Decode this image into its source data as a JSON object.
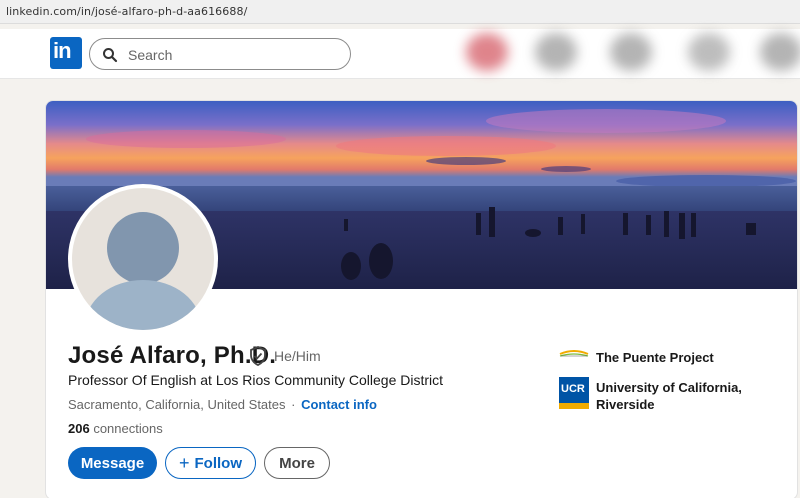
{
  "browser": {
    "url": "linkedin.com/in/josé-alfaro-ph-d-aa616688/"
  },
  "nav": {
    "logo_text": "in",
    "search_placeholder": "Search",
    "search_icon": "search-icon"
  },
  "profile": {
    "name": "José Alfaro, Ph.D.",
    "verified_icon": "verified-shield-icon",
    "pronouns": "He/Him",
    "headline": "Professor Of English at Los Rios Community College District",
    "location": "Sacramento, California, United States",
    "separator": "·",
    "contact_info_label": "Contact info",
    "connections_count": "206",
    "connections_label": "connections"
  },
  "actions": {
    "message_label": "Message",
    "follow_plus": "+",
    "follow_label": "Follow",
    "more_label": "More"
  },
  "organizations": [
    {
      "name": "The Puente Project",
      "logo": "puente-logo"
    },
    {
      "name": "University of California, Riverside",
      "logo": "ucr-logo",
      "logo_text": "UCR"
    }
  ],
  "colors": {
    "brand_blue": "#0a66c2",
    "page_bg": "#f4f2ee",
    "ucr_blue": "#0054a6",
    "ucr_gold": "#f1ab00"
  }
}
